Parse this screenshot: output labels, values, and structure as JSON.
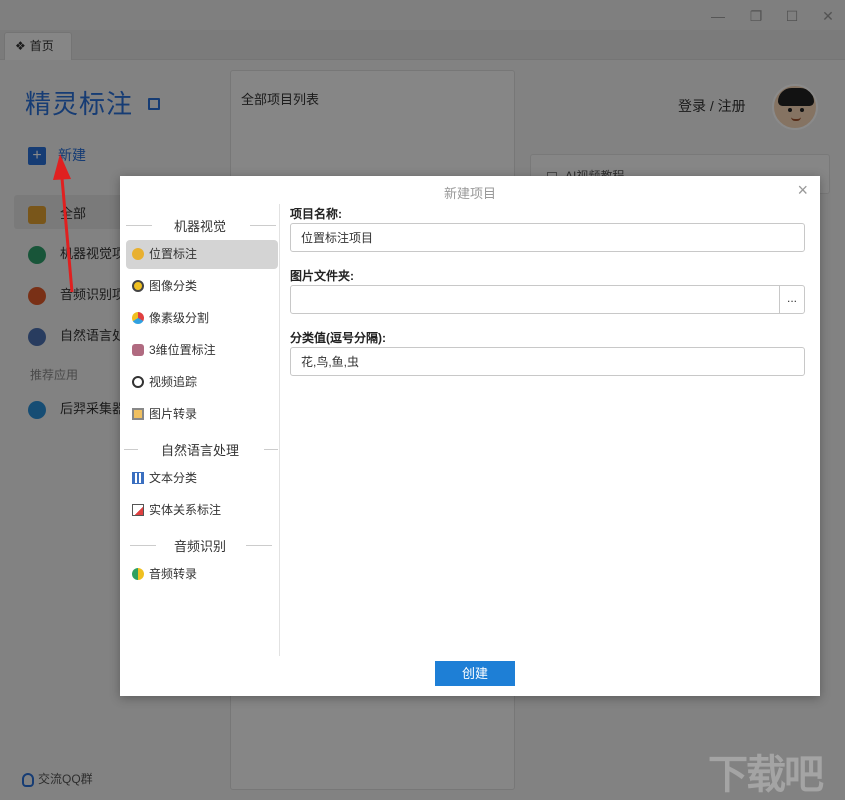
{
  "tabs": [
    {
      "label": "首页"
    }
  ],
  "app": {
    "title": "精灵标注",
    "new_label": "新建"
  },
  "sidebar": {
    "items": [
      {
        "label": "全部",
        "color": "#e0a030"
      },
      {
        "label": "机器视觉项目",
        "color": "#2e9e6a"
      },
      {
        "label": "音频识别项目",
        "color": "#e05a2a"
      },
      {
        "label": "自然语言处理",
        "color": "#4a6fb0"
      }
    ],
    "section_label": "推荐应用",
    "apps": [
      {
        "label": "后羿采集器",
        "color": "#2a8fd6"
      }
    ],
    "qq_label": "交流QQ群"
  },
  "projects_panel": {
    "title": "全部项目列表"
  },
  "header": {
    "login_label": "登录 / 注册"
  },
  "right_card": {
    "label": "AI视频教程"
  },
  "dialog": {
    "title": "新建项目",
    "close_glyph": "×",
    "categories": [
      {
        "heading": "机器视觉",
        "items": [
          {
            "label": "位置标注",
            "icon": "location-tag-icon",
            "active": true
          },
          {
            "label": "图像分类",
            "icon": "image-classify-icon"
          },
          {
            "label": "像素级分割",
            "icon": "pixel-segment-icon"
          },
          {
            "label": "3维位置标注",
            "icon": "cube-3d-icon"
          },
          {
            "label": "视频追踪",
            "icon": "video-track-icon"
          },
          {
            "label": "图片转录",
            "icon": "image-transcribe-icon"
          }
        ]
      },
      {
        "heading": "自然语言处理",
        "items": [
          {
            "label": "文本分类",
            "icon": "text-classify-icon"
          },
          {
            "label": "实体关系标注",
            "icon": "entity-relation-icon"
          }
        ]
      },
      {
        "heading": "音频识别",
        "items": [
          {
            "label": "音频转录",
            "icon": "audio-transcribe-icon"
          }
        ]
      }
    ],
    "form": {
      "name_label": "项目名称:",
      "name_value": "位置标注项目",
      "folder_label": "图片文件夹:",
      "folder_value": "",
      "browse_label": "...",
      "classes_label": "分类值(逗号分隔):",
      "classes_value": "花,鸟,鱼,虫"
    },
    "create_label": "创建"
  },
  "colors": {
    "accent": "#1e7fd6",
    "brand_blue": "#2a6fd6",
    "annotation_red": "#e02020"
  }
}
